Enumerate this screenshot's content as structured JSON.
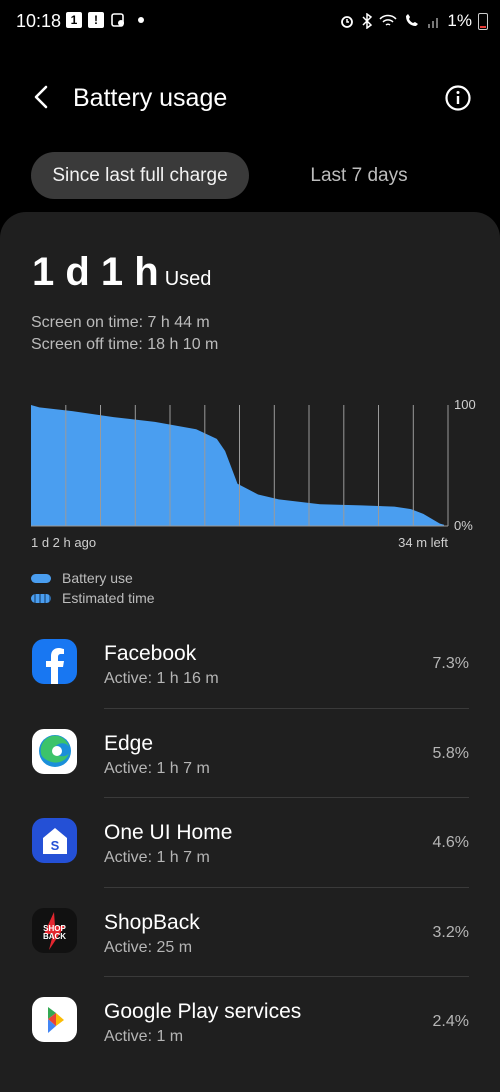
{
  "status_bar": {
    "time": "10:18",
    "notif_1": "1",
    "notif_2": "!",
    "battery": "1%"
  },
  "header": {
    "title": "Battery usage"
  },
  "tabs": {
    "active": "Since last full charge",
    "inactive": "Last 7 days"
  },
  "summary": {
    "used_value": "1 d 1 h",
    "used_label": "Used",
    "screen_on": "Screen on time: 7 h 44 m",
    "screen_off": "Screen off time: 18 h 10 m"
  },
  "chart_data": {
    "type": "area",
    "x_start_label": "1 d 2 h ago",
    "x_end_label": "34 m left",
    "y_max_label": "100",
    "y_min_label": "0%",
    "ylim": [
      0,
      100
    ],
    "series": [
      {
        "name": "Battery use",
        "x": [
          0,
          0.02,
          0.1,
          0.2,
          0.3,
          0.4,
          0.45,
          0.47,
          0.5,
          0.55,
          0.6,
          0.7,
          0.8,
          0.88,
          0.92,
          0.95,
          0.97,
          0.99,
          1.0
        ],
        "values": [
          100,
          98,
          95,
          90,
          86,
          80,
          72,
          62,
          35,
          26,
          22,
          18,
          17,
          16,
          14,
          10,
          6,
          2,
          1
        ]
      }
    ],
    "gridlines": 12
  },
  "legend": {
    "battery_use": "Battery use",
    "estimated_time": "Estimated time"
  },
  "apps": [
    {
      "name": "Facebook",
      "active": "Active: 1 h 16 m",
      "percent": "7.3%",
      "icon": "facebook-icon"
    },
    {
      "name": "Edge",
      "active": "Active: 1 h 7 m",
      "percent": "5.8%",
      "icon": "edge-icon"
    },
    {
      "name": "One UI Home",
      "active": "Active: 1 h 7 m",
      "percent": "4.6%",
      "icon": "one-ui-home-icon"
    },
    {
      "name": "ShopBack",
      "active": "Active: 25 m",
      "percent": "3.2%",
      "icon": "shopback-icon"
    },
    {
      "name": "Google Play services",
      "active": "Active: 1 m",
      "percent": "2.4%",
      "icon": "google-play-services-icon"
    }
  ],
  "shopback_logo_text": [
    "SHOP",
    "BACK"
  ],
  "colors": {
    "accent": "#4a9ef0",
    "card": "#1f1f1f"
  }
}
